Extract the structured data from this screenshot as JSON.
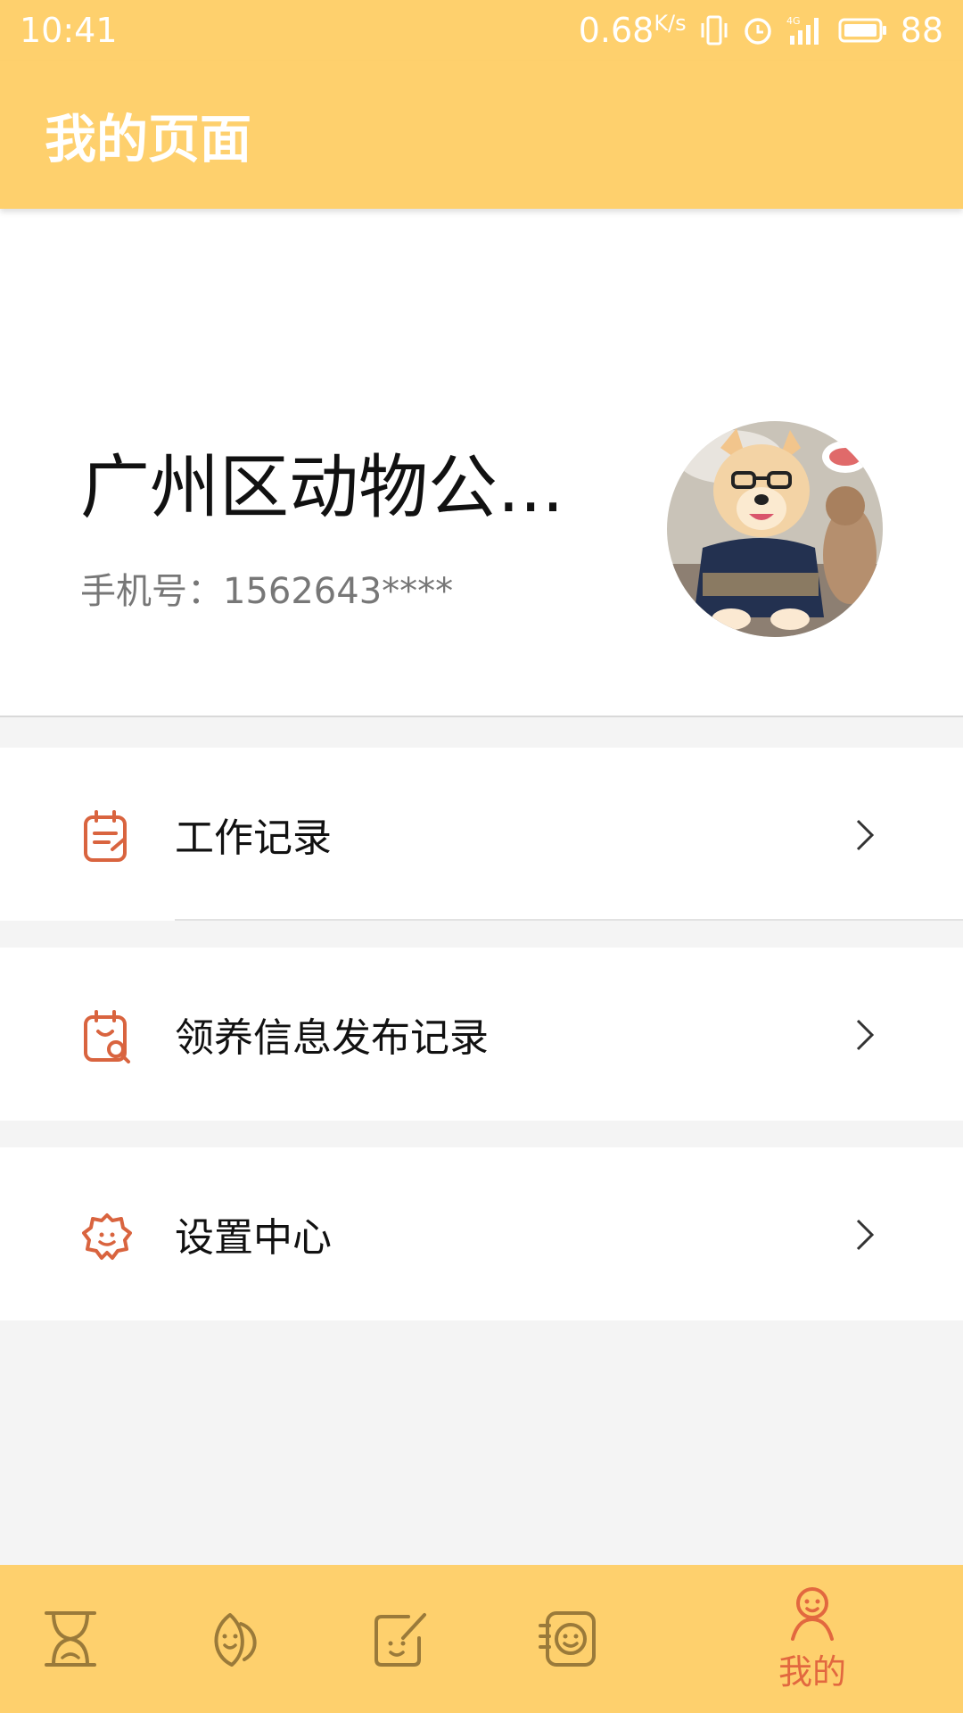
{
  "status_bar": {
    "time": "10:41",
    "network_speed": "0.68",
    "network_unit": "K/s",
    "signal_type": "4G",
    "battery": "88"
  },
  "header": {
    "title": "我的页面"
  },
  "profile": {
    "name": "广州区动物公...",
    "phone": "手机号：1562643****",
    "avatar": "dog-avatar-photo"
  },
  "menu": [
    {
      "label": "工作记录",
      "icon": "clipboard-note-icon"
    },
    {
      "label": "领养信息发布记录",
      "icon": "clipboard-search-icon"
    },
    {
      "label": "设置中心",
      "icon": "gear-icon"
    }
  ],
  "tabs": [
    {
      "icon": "hourglass-icon",
      "label": ""
    },
    {
      "icon": "leaf-icon",
      "label": ""
    },
    {
      "icon": "edit-note-icon",
      "label": ""
    },
    {
      "icon": "face-list-icon",
      "label": ""
    },
    {
      "icon": "person-icon",
      "label": "我的",
      "active": true
    }
  ],
  "colors": {
    "primary": "#fed06d",
    "accent": "#e2683f",
    "tab_icon": "#9a7a3a"
  }
}
